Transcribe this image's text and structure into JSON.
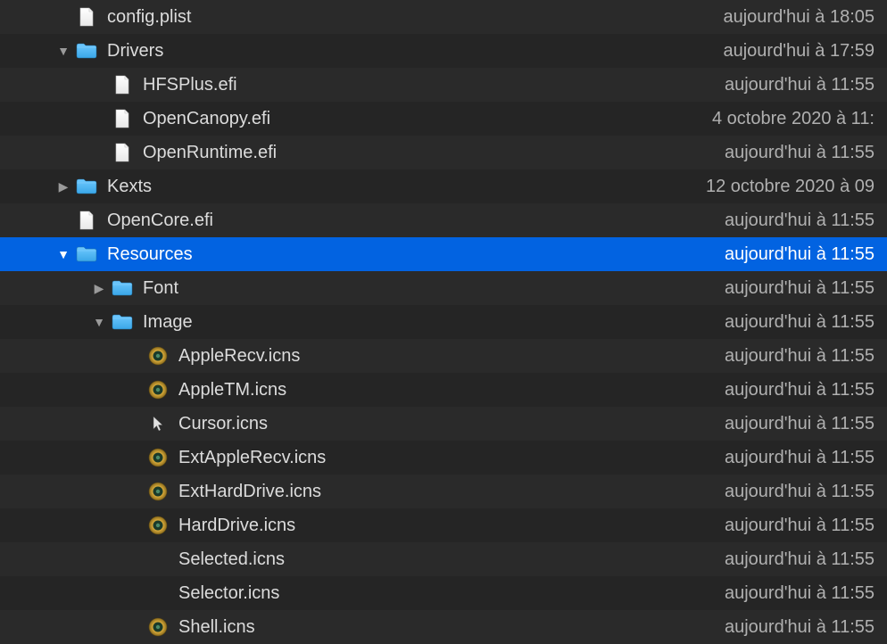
{
  "files": [
    {
      "name": "config.plist",
      "date": "aujourd'hui à 18:05",
      "indent": 1,
      "expand": "none",
      "icon": "file",
      "selected": false
    },
    {
      "name": "Drivers",
      "date": "aujourd'hui à 17:59",
      "indent": 1,
      "expand": "open",
      "icon": "folder",
      "selected": false
    },
    {
      "name": "HFSPlus.efi",
      "date": "aujourd'hui à 11:55",
      "indent": 2,
      "expand": "none",
      "icon": "file",
      "selected": false
    },
    {
      "name": "OpenCanopy.efi",
      "date": "4 octobre 2020 à 11:",
      "indent": 2,
      "expand": "none",
      "icon": "file",
      "selected": false
    },
    {
      "name": "OpenRuntime.efi",
      "date": "aujourd'hui à 11:55",
      "indent": 2,
      "expand": "none",
      "icon": "file",
      "selected": false
    },
    {
      "name": "Kexts",
      "date": "12 octobre 2020 à 09",
      "indent": 1,
      "expand": "closed",
      "icon": "folder",
      "selected": false
    },
    {
      "name": "OpenCore.efi",
      "date": "aujourd'hui à 11:55",
      "indent": 1,
      "expand": "none",
      "icon": "file",
      "selected": false
    },
    {
      "name": "Resources",
      "date": "aujourd'hui à 11:55",
      "indent": 1,
      "expand": "open",
      "icon": "folder",
      "selected": true
    },
    {
      "name": "Font",
      "date": "aujourd'hui à 11:55",
      "indent": 2,
      "expand": "closed",
      "icon": "folder",
      "selected": false
    },
    {
      "name": "Image",
      "date": "aujourd'hui à 11:55",
      "indent": 2,
      "expand": "open",
      "icon": "folder",
      "selected": false
    },
    {
      "name": "AppleRecv.icns",
      "date": "aujourd'hui à 11:55",
      "indent": 3,
      "expand": "none",
      "icon": "icns",
      "selected": false
    },
    {
      "name": "AppleTM.icns",
      "date": "aujourd'hui à 11:55",
      "indent": 3,
      "expand": "none",
      "icon": "icns",
      "selected": false
    },
    {
      "name": "Cursor.icns",
      "date": "aujourd'hui à 11:55",
      "indent": 3,
      "expand": "none",
      "icon": "cursor",
      "selected": false
    },
    {
      "name": "ExtAppleRecv.icns",
      "date": "aujourd'hui à 11:55",
      "indent": 3,
      "expand": "none",
      "icon": "icns",
      "selected": false
    },
    {
      "name": "ExtHardDrive.icns",
      "date": "aujourd'hui à 11:55",
      "indent": 3,
      "expand": "none",
      "icon": "icns",
      "selected": false
    },
    {
      "name": "HardDrive.icns",
      "date": "aujourd'hui à 11:55",
      "indent": 3,
      "expand": "none",
      "icon": "icns",
      "selected": false
    },
    {
      "name": "Selected.icns",
      "date": "aujourd'hui à 11:55",
      "indent": 3,
      "expand": "none",
      "icon": "blank",
      "selected": false
    },
    {
      "name": "Selector.icns",
      "date": "aujourd'hui à 11:55",
      "indent": 3,
      "expand": "none",
      "icon": "blank",
      "selected": false
    },
    {
      "name": "Shell.icns",
      "date": "aujourd'hui à 11:55",
      "indent": 3,
      "expand": "none",
      "icon": "icns",
      "selected": false
    }
  ]
}
